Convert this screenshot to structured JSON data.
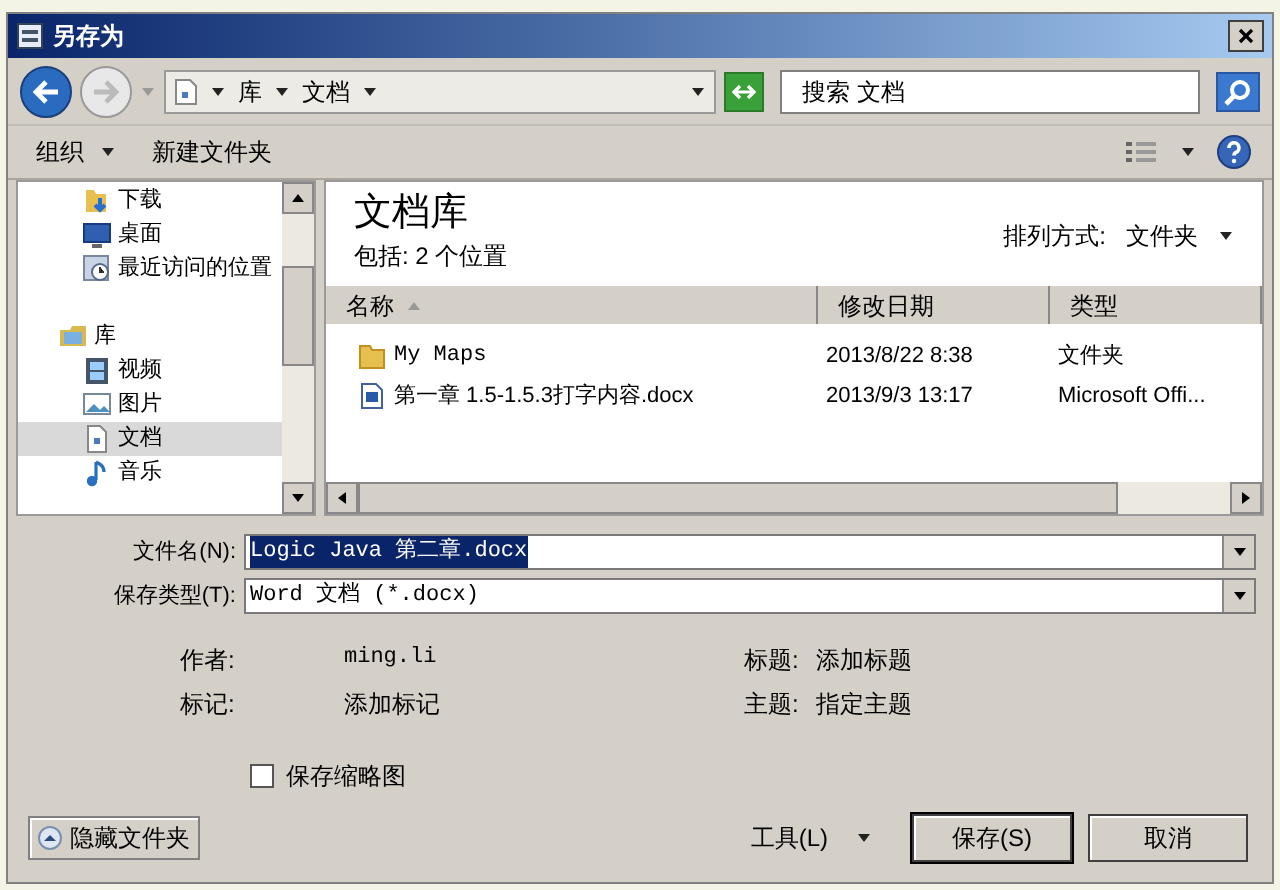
{
  "window": {
    "title": "另存为"
  },
  "breadcrumb": [
    "库",
    "文档"
  ],
  "search": {
    "placeholder": "搜索 文档"
  },
  "toolbar": [
    {
      "label": "组织",
      "kind": "menu"
    },
    {
      "label": "新建文件夹",
      "kind": "button"
    }
  ],
  "nav": [
    {
      "label": "下载",
      "kind": "download",
      "selected": false
    },
    {
      "label": "桌面",
      "kind": "desktop",
      "selected": false
    },
    {
      "label": "最近访问的位置",
      "kind": "recent",
      "selected": false
    },
    {
      "label": "库",
      "kind": "library",
      "selected": false,
      "children": [
        {
          "label": "视频",
          "kind": "video",
          "selected": false
        },
        {
          "label": "图片",
          "kind": "picture",
          "selected": false
        },
        {
          "label": "文档",
          "kind": "document",
          "selected": true
        },
        {
          "label": "音乐",
          "kind": "music",
          "selected": false
        }
      ]
    }
  ],
  "library": {
    "title": "文档库",
    "subtitle": "包括: 2 个位置",
    "arrange_label": "排列方式:",
    "arrange_value": "文件夹"
  },
  "table": {
    "columns": [
      {
        "label": "名称",
        "sorted": true
      },
      {
        "label": "修改日期",
        "sorted": false
      },
      {
        "label": "类型",
        "sorted": false
      }
    ],
    "rows": [
      {
        "kind": "folder",
        "cells": [
          "My Maps",
          "2013/8/22 8:38",
          "文件夹"
        ]
      },
      {
        "kind": "document",
        "cells": [
          "第一章 1.5-1.5.3打字内容.docx",
          "2013/9/3 13:17",
          "Microsoft Offi..."
        ]
      }
    ]
  },
  "form": [
    {
      "label": "文件名(N):",
      "value": "Logic Java 第二章.docx",
      "selected": true
    },
    {
      "label": "保存类型(T):",
      "value": "Word 文档 (*.docx)",
      "selected": false
    }
  ],
  "metadata": [
    {
      "label": "作者:",
      "value": "ming.li"
    },
    {
      "label": "标题:",
      "value": "添加标题"
    },
    {
      "label": "标记:",
      "value": "添加标记"
    },
    {
      "label": "主题:",
      "value": "指定主题"
    }
  ],
  "checkbox": {
    "label": "保存缩略图",
    "checked": false
  },
  "hide_folders": "隐藏文件夹",
  "tools": "工具(L)",
  "buttons": [
    "保存(S)",
    "取消"
  ]
}
